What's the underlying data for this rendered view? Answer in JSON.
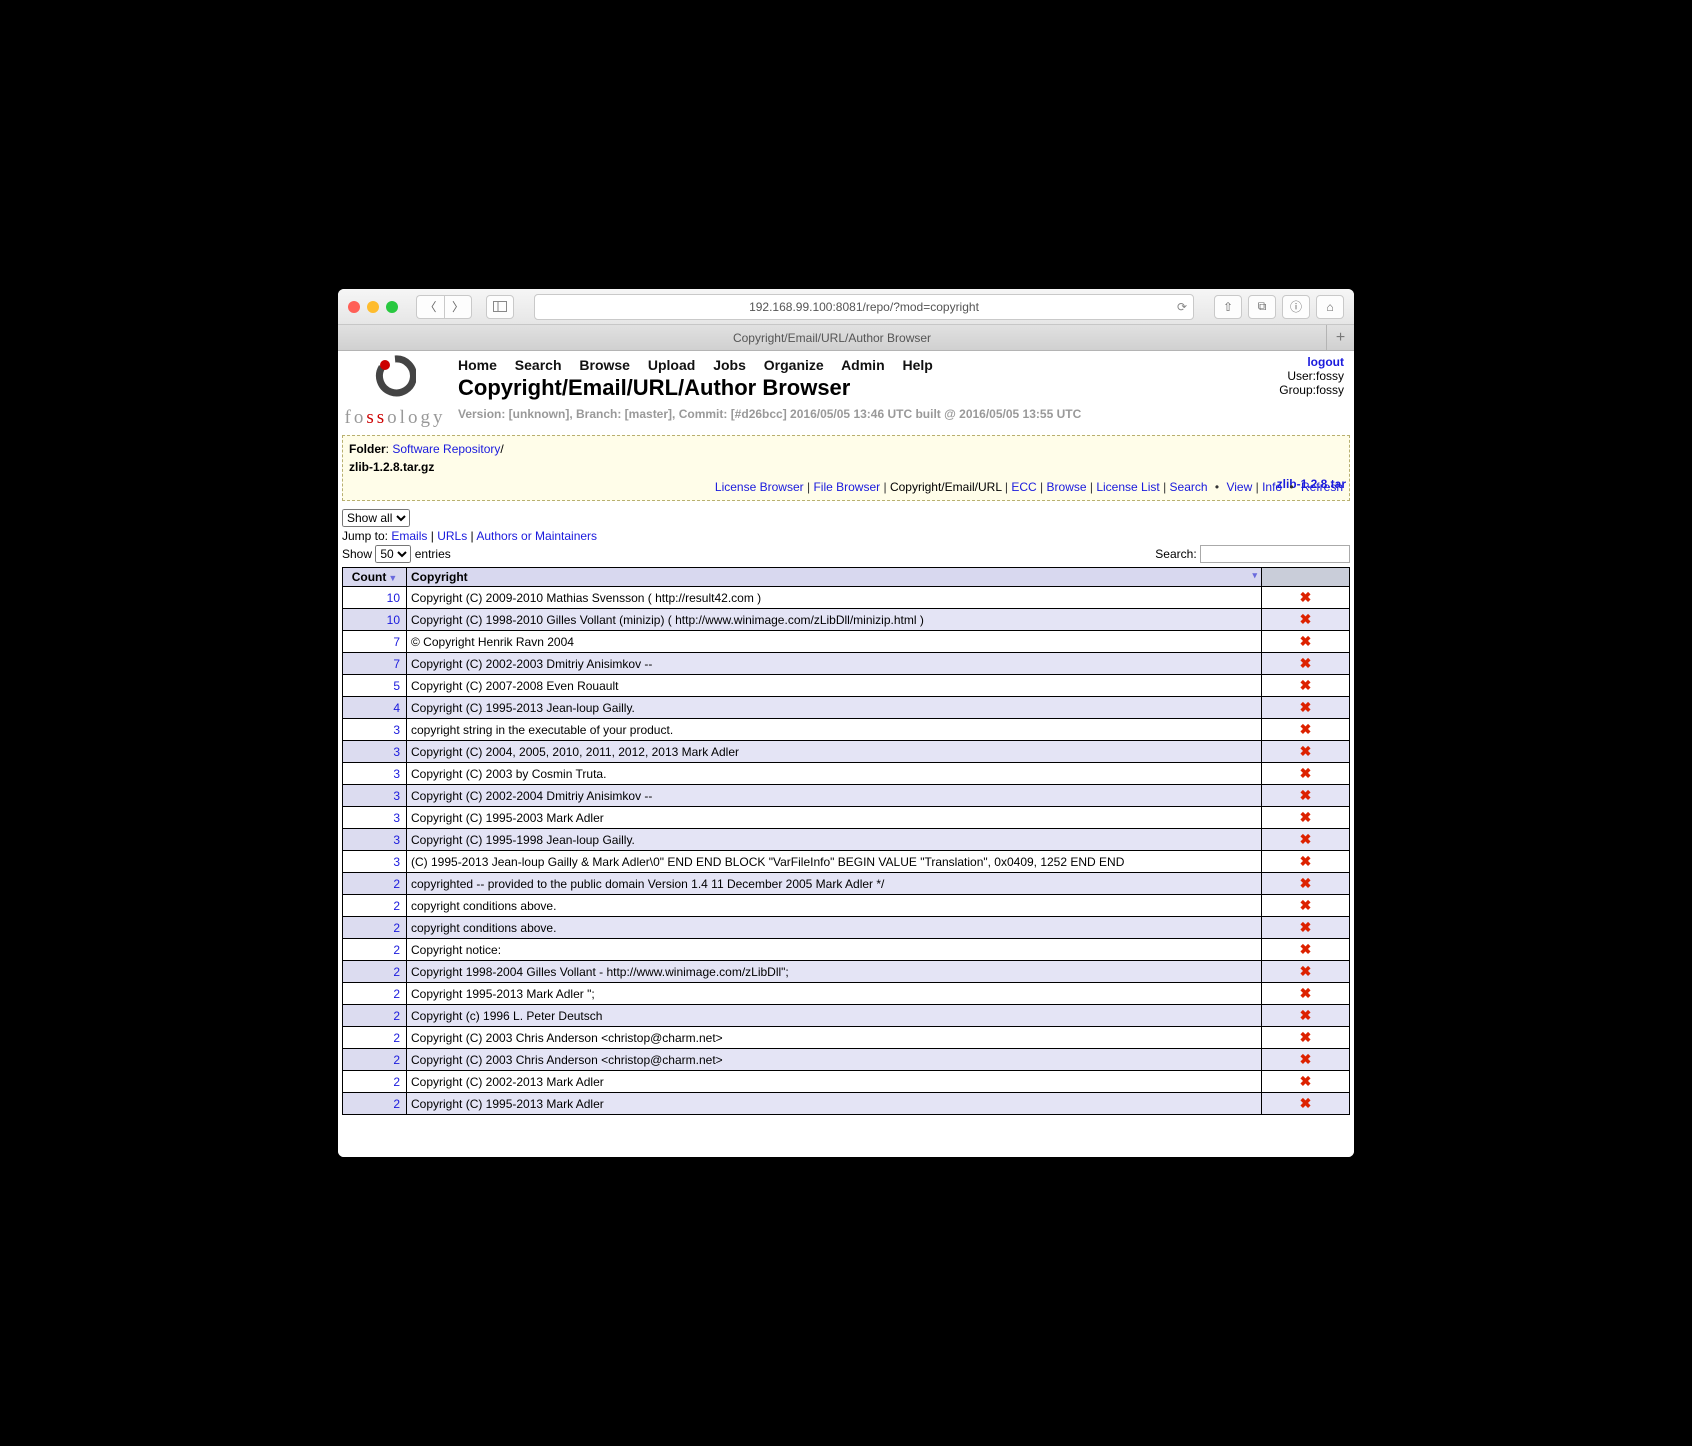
{
  "browser": {
    "url": "192.168.99.100:8081/repo/?mod=copyright",
    "tab_title": "Copyright/Email/URL/Author Browser"
  },
  "mainmenu": [
    "Home",
    "Search",
    "Browse",
    "Upload",
    "Jobs",
    "Organize",
    "Admin",
    "Help"
  ],
  "page_title": "Copyright/Email/URL/Author Browser",
  "version_line": "Version: [unknown], Branch: [master], Commit: [#d26bcc] 2016/05/05 13:46 UTC built @ 2016/05/05 13:55 UTC",
  "userbox": {
    "logout": "logout",
    "user": "User:fossy",
    "group": "Group:fossy"
  },
  "folder": {
    "label": "Folder",
    "repo": "Software Repository",
    "file": "zlib-1.2.8.tar.gz"
  },
  "subnav": {
    "license_browser": "License Browser",
    "file_browser": "File Browser",
    "current": "Copyright/Email/URL",
    "ecc": "ECC",
    "browse": "Browse",
    "license_list": "License List",
    "search": "Search",
    "view": "View",
    "info": "Info",
    "refresh": "Refresh"
  },
  "showall_selected": "Show all",
  "jump": {
    "label": "Jump to:",
    "emails": "Emails",
    "urls": "URLs",
    "authors": "Authors or Maintainers"
  },
  "show": {
    "label": "Show",
    "value": "50",
    "entries": "entries"
  },
  "search_label": "Search:",
  "sidelink": "zlib-1.2.8.tar",
  "table": {
    "headers": {
      "count": "Count",
      "copyright": "Copyright"
    },
    "rows": [
      {
        "count": 10,
        "text": "Copyright (C) 2009-2010 Mathias Svensson ( http://result42.com )"
      },
      {
        "count": 10,
        "text": "Copyright (C) 1998-2010 Gilles Vollant (minizip) ( http://www.winimage.com/zLibDll/minizip.html )"
      },
      {
        "count": 7,
        "text": "© Copyright Henrik Ravn 2004"
      },
      {
        "count": 7,
        "text": "Copyright (C) 2002-2003 Dmitriy Anisimkov --"
      },
      {
        "count": 5,
        "text": "Copyright (C) 2007-2008 Even Rouault"
      },
      {
        "count": 4,
        "text": "Copyright (C) 1995-2013 Jean-loup Gailly."
      },
      {
        "count": 3,
        "text": "copyright string in the executable of your product."
      },
      {
        "count": 3,
        "text": "Copyright (C) 2004, 2005, 2010, 2011, 2012, 2013 Mark Adler"
      },
      {
        "count": 3,
        "text": "Copyright (C) 2003 by Cosmin Truta."
      },
      {
        "count": 3,
        "text": "Copyright (C) 2002-2004 Dmitriy Anisimkov --"
      },
      {
        "count": 3,
        "text": "Copyright (C) 1995-2003 Mark Adler"
      },
      {
        "count": 3,
        "text": "Copyright (C) 1995-1998 Jean-loup Gailly."
      },
      {
        "count": 3,
        "text": "(C) 1995-2013 Jean-loup Gailly & Mark Adler\\0\" END END BLOCK \"VarFileInfo\" BEGIN VALUE \"Translation\", 0x0409, 1252 END END"
      },
      {
        "count": 2,
        "text": "copyrighted -- provided to the public domain Version 1.4 11 December 2005 Mark Adler */"
      },
      {
        "count": 2,
        "text": "copyright conditions above."
      },
      {
        "count": 2,
        "text": "copyright conditions above."
      },
      {
        "count": 2,
        "text": "Copyright notice:"
      },
      {
        "count": 2,
        "text": "Copyright 1998-2004 Gilles Vollant - http://www.winimage.com/zLibDll\";"
      },
      {
        "count": 2,
        "text": "Copyright 1995-2013 Mark Adler \";"
      },
      {
        "count": 2,
        "text": "Copyright (c) 1996 L. Peter Deutsch"
      },
      {
        "count": 2,
        "text": "Copyright (C) 2003 Chris Anderson <christop@charm.net>"
      },
      {
        "count": 2,
        "text": "Copyright (C) 2003 Chris Anderson <christop@charm.net>"
      },
      {
        "count": 2,
        "text": "Copyright (C) 2002-2013 Mark Adler"
      },
      {
        "count": 2,
        "text": "Copyright (C) 1995-2013 Mark Adler"
      }
    ]
  }
}
